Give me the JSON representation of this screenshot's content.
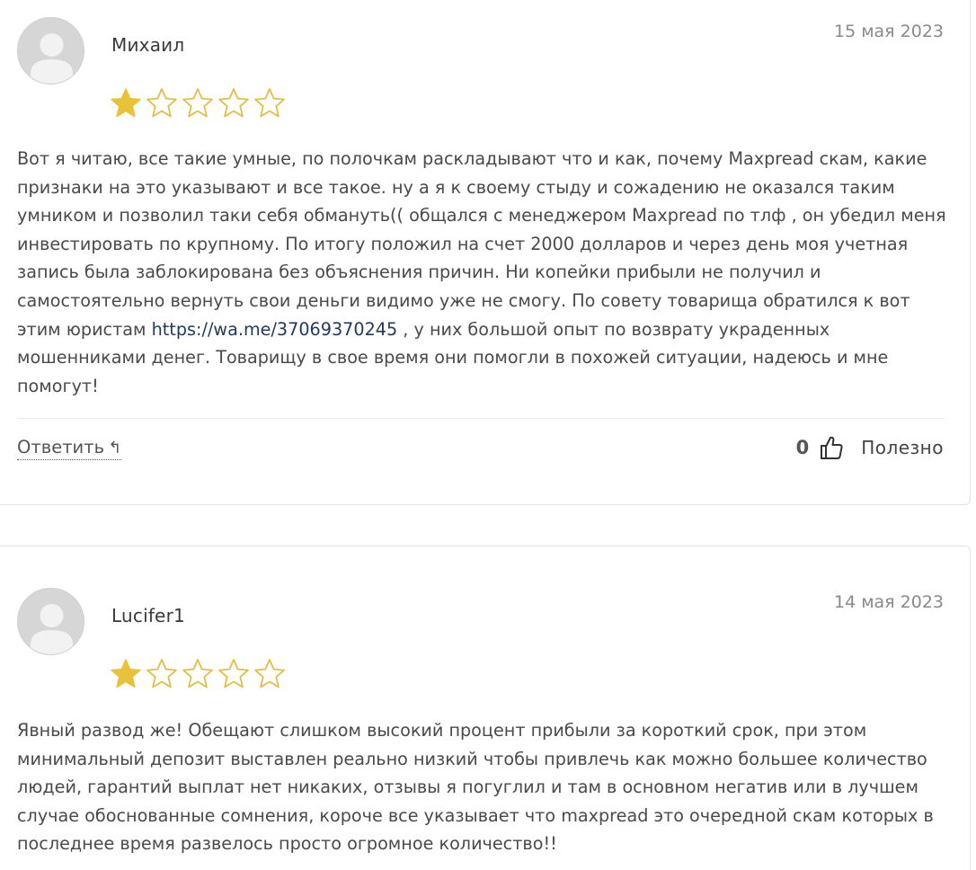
{
  "reviews": [
    {
      "author": "Михаил",
      "date": "15 мая 2023",
      "rating": 1,
      "rating_max": 5,
      "text_before_link": "Вот я читаю, все такие умные, по полочкам раскладывают что и как, почему Maxpread скам, какие признаки на это указывают и все такое. ну а я к своему стыду и сожадению не оказался таким умником и позволил таки себя обмануть(( общался с менеджером Maxpread по тлф , он убедил меня инвестировать по крупному. По итогу положил на счет 2000 долларов и через день моя учетная запись была заблокирована без объяснения причин. Ни копейки прибыли не получил и самостоятельно вернуть свои деньги видимо уже не смогу. По совету товарища обратился к вот этим юристам ",
      "link": "https://wa.me/37069370245",
      "text_after_link": " , у них большой опыт по возврату украденных мошенниками денег. Товарищу в свое время они помогли в похожей ситуации, надеюсь и мне помогут!",
      "reply_label": "Ответить",
      "reply_arrow": "↰",
      "votes": "0",
      "useful_label": "Полезно"
    },
    {
      "author": "Lucifer1",
      "date": "14 мая 2023",
      "rating": 1,
      "rating_max": 5,
      "text": "Явный развод же! Обещают слишком высокий процент прибыли за короткий срок, при этом минимальный депозит выставлен реально низкий чтобы привлечь как можно большее количество людей, гарантий выплат нет никаких, отзывы я погуглил и там в основном негатив или в лучшем случае обоснованные сомнения, короче все указывает что maxpread это очередной скам которых в последнее время развелось просто огромное количество!!"
    }
  ],
  "colors": {
    "star_filled": "#e8c33a",
    "star_outline": "#e0bf48",
    "link": "#1f3a5a",
    "text": "#4a4a4a",
    "date": "#8a8a8a"
  },
  "icons": {
    "avatar": "user-avatar-icon",
    "star": "star-icon",
    "reply": "reply-arrow-icon",
    "thumb": "thumbs-up-icon"
  }
}
